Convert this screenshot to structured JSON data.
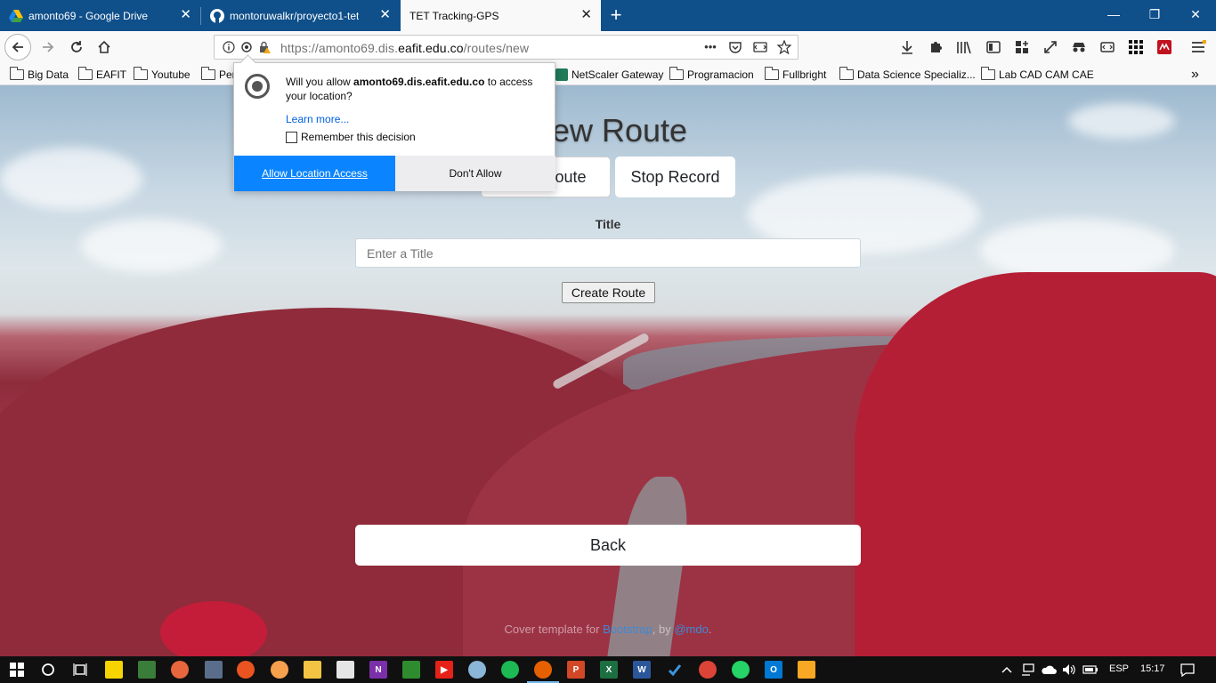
{
  "browser": {
    "tabs": [
      {
        "label": "amonto69 - Google Drive",
        "icon": "google-drive-icon",
        "active": false
      },
      {
        "label": "montoruwalkr/proyecto1-tet",
        "icon": "github-icon",
        "active": false
      },
      {
        "label": "TET Tracking-GPS",
        "icon": "",
        "active": true
      }
    ],
    "new_tab_symbol": "+",
    "url_prefix": "https://amonto69.dis.",
    "url_domain": "eafit.edu.co",
    "url_path": "/routes/new",
    "url_more": "•••"
  },
  "bookmarks": [
    "Big Data",
    "EAFIT",
    "Youtube",
    "Per",
    "NetScaler Gateway",
    "Programacion",
    "Fullbright",
    "Data Science Specializ...",
    "Lab CAD CAM CAE"
  ],
  "bookmarks_overflow": "»",
  "permission": {
    "prompt_before": "Will you allow ",
    "prompt_host": "amonto69.dis.eafit.edu.co",
    "prompt_after": " to access your location?",
    "learn_more": "Learn more...",
    "remember": "Remember this decision",
    "allow_label": "Allow Location Access",
    "deny_label": "Don't Allow",
    "allow_color": "#0a84ff"
  },
  "page": {
    "heading": "New Route",
    "start_button": "Start Route",
    "stop_button": "Stop Record",
    "title_label": "Title",
    "title_placeholder": "Enter a Title",
    "create_button": "Create Route",
    "back_button": "Back",
    "footer_prefix": "Cover template for ",
    "footer_link1": "Bootstrap",
    "footer_mid": ", by ",
    "footer_link2": "@mdo",
    "footer_suffix": "."
  },
  "taskbar": {
    "language": "ESP",
    "time": "15:17"
  }
}
